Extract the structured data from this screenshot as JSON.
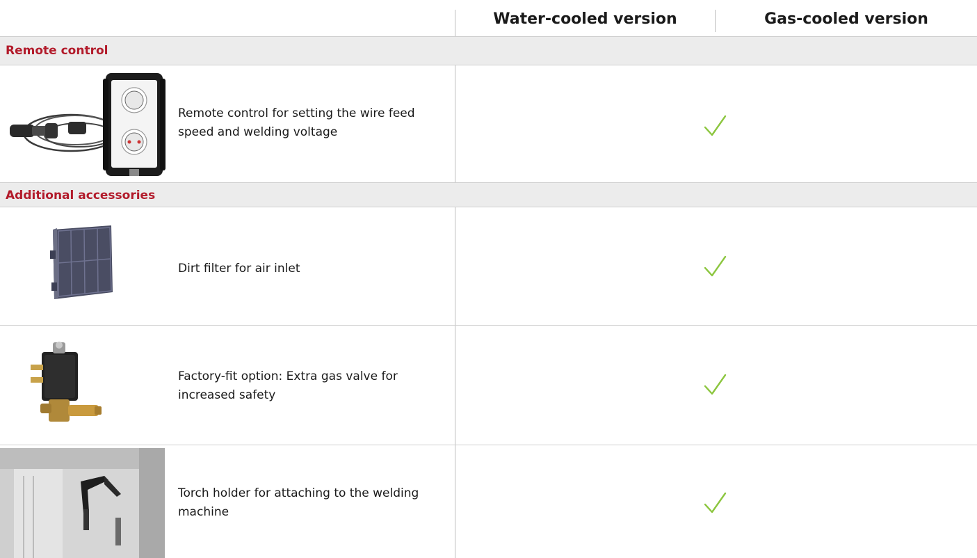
{
  "header": {
    "water_label": "Water-cooled version",
    "gas_label": "Gas-cooled version"
  },
  "sections": {
    "remote": {
      "title": "Remote control"
    },
    "additional": {
      "title": "Additional accessories"
    }
  },
  "rows": {
    "remote_control": {
      "text": "Remote control for setting the wire feed speed and welding voltage",
      "included": true
    },
    "dirt_filter": {
      "text": "Dirt filter for air inlet",
      "included": true
    },
    "gas_valve": {
      "text": "Factory-fit option: Extra gas valve for increased safety",
      "included": true
    },
    "torch_holder": {
      "text": "Torch holder for attaching to the welding machine",
      "included": true
    }
  },
  "colors": {
    "section_title": "#b21a2a",
    "section_bg": "#ececec",
    "check": "#8cc63f",
    "divider": "#bdbdbd"
  },
  "icons": {
    "check": "check-mark-icon"
  }
}
